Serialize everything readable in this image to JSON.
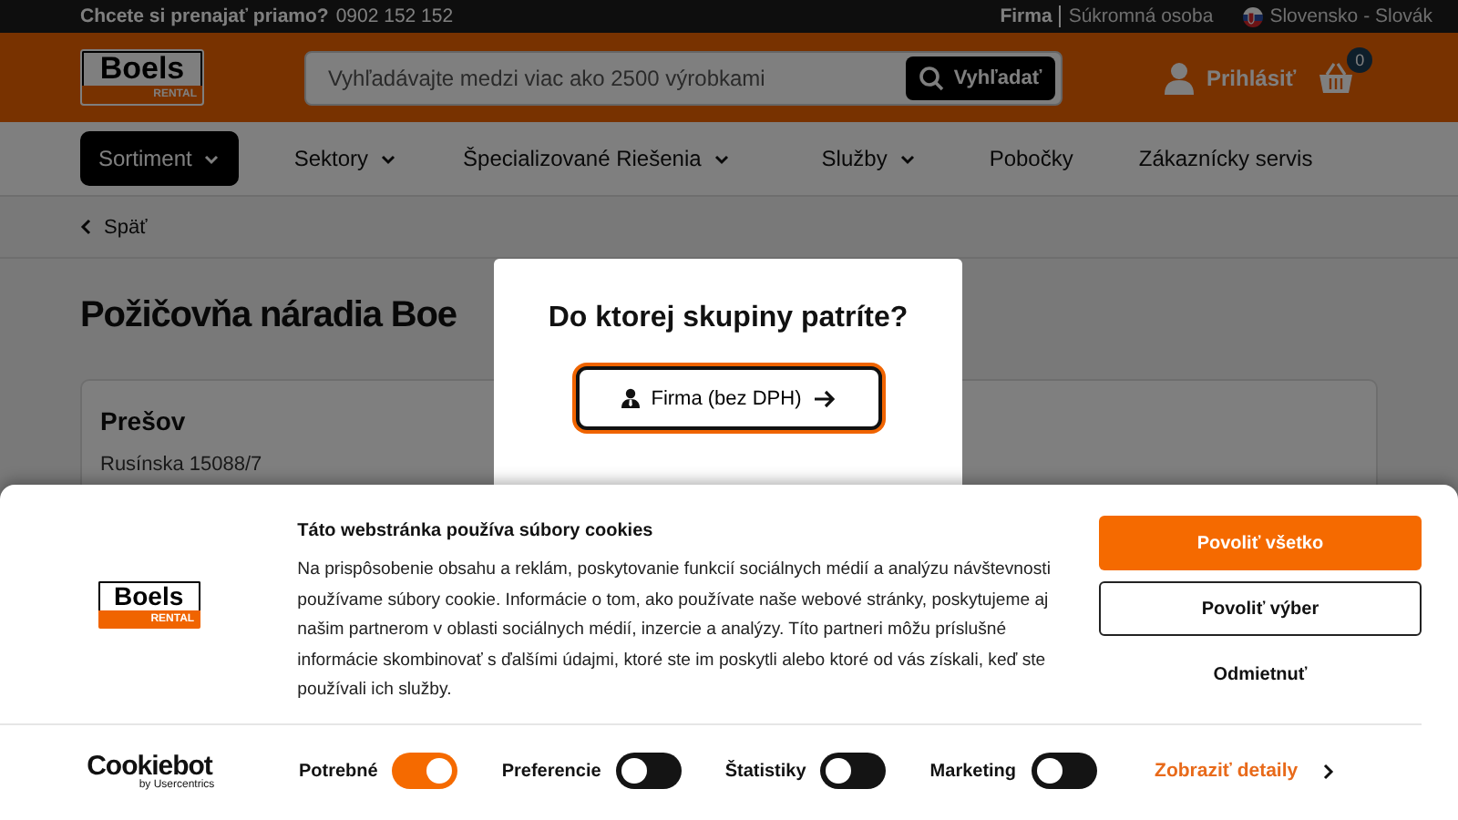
{
  "top_bar": {
    "prompt": "Chcete si prenajať priamo?",
    "phone": "0902 152 152",
    "customer_types": [
      {
        "label": "Firma",
        "selected": true
      },
      {
        "label": "Súkromná osoba",
        "selected": false
      }
    ],
    "language": "Slovensko - Slovák"
  },
  "header": {
    "logo": "Boels",
    "logo_sub": "RENTAL",
    "search": {
      "placeholder": "Vyhľadávajte medzi viac ako 2500 výrobkami",
      "button": "Vyhľadať"
    },
    "login": "Prihlásiť",
    "cart_count": "0"
  },
  "nav": [
    {
      "label": "Sortiment",
      "selected": true,
      "has_menu": true
    },
    {
      "label": "Sektory",
      "selected": false,
      "has_menu": true
    },
    {
      "label": "Špecializované Riešenia",
      "selected": false,
      "has_menu": true
    },
    {
      "label": "Služby",
      "selected": false,
      "has_menu": true
    },
    {
      "label": "Pobočky",
      "selected": false,
      "has_menu": false
    },
    {
      "label": "Zákaznícky servis",
      "selected": false,
      "has_menu": false
    }
  ],
  "back": "Späť",
  "page_title": "Požičovňa náradia Boe",
  "branch": {
    "name": "Prešov",
    "lines": [
      "Rusínska 15088/7"
    ]
  },
  "modal": {
    "title": "Do ktorej skupiny patríte?",
    "options": [
      {
        "label": "Firma (bez DPH)",
        "selected": true
      }
    ]
  },
  "cookie_banner": {
    "logo": "Boels",
    "logo_sub": "RENTAL",
    "title": "Táto webstránka používa súbory cookies",
    "text": "Na prispôsobenie obsahu a reklám, poskytovanie funkcií sociálnych médií a analýzu návštevnosti používame súbory cookie. Informácie o tom, ako používate naše webové stránky, poskytujeme aj našim partnerom v oblasti sociálnych médií, inzercie a analýzy. Títo partneri môžu príslušné informácie skombinovať s ďalšími údajmi, ktoré ste im poskytli alebo ktoré od vás získali, keď ste používali ich služby.",
    "buttons": [
      {
        "label": "Povoliť všetko",
        "kind": "primary"
      },
      {
        "label": "Povoliť výber",
        "kind": "outline"
      },
      {
        "label": "Odmietnuť",
        "kind": "plain"
      }
    ],
    "toggles": [
      {
        "label": "Potrebné",
        "on": true
      },
      {
        "label": "Preferencie",
        "on": false
      },
      {
        "label": "Štatistiky",
        "on": false
      },
      {
        "label": "Marketing",
        "on": false
      }
    ],
    "details_link": "Zobraziť detaily",
    "brand": "Cookiebot",
    "brand_sub": "by Usercentrics"
  }
}
